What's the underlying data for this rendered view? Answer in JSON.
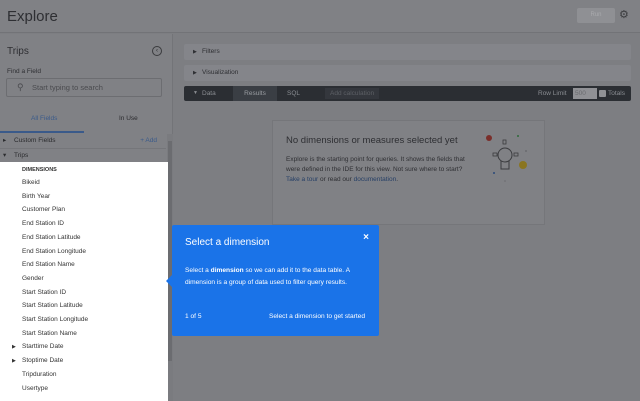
{
  "header": {
    "title": "Explore",
    "run_label": "Run",
    "gear_icon": "gear-icon"
  },
  "sidebar": {
    "title": "Trips",
    "find_label": "Find a Field",
    "search_placeholder": "Start typing to search",
    "tabs": [
      {
        "label": "All Fields"
      },
      {
        "label": "In Use"
      }
    ],
    "custom_fields": "Custom Fields",
    "add_label": "+ Add",
    "trips": "Trips",
    "dimensions_header": "DIMENSIONS",
    "fields": [
      {
        "label": "Bikeid"
      },
      {
        "label": "Birth Year"
      },
      {
        "label": "Customer Plan"
      },
      {
        "label": "End Station ID"
      },
      {
        "label": "End Station Latitude"
      },
      {
        "label": "End Station Longitude"
      },
      {
        "label": "End Station Name"
      },
      {
        "label": "Gender"
      },
      {
        "label": "Start Station ID"
      },
      {
        "label": "Start Station Latitude"
      },
      {
        "label": "Start Station Longitude"
      },
      {
        "label": "Start Station Name"
      },
      {
        "label": "Starttime Date",
        "expandable": true
      },
      {
        "label": "Stoptime Date",
        "expandable": true
      },
      {
        "label": "Tripduration"
      },
      {
        "label": "Usertype"
      }
    ]
  },
  "main": {
    "filters": "Filters",
    "visualization": "Visualization",
    "data_bar": {
      "data": "Data",
      "results": "Results",
      "sql": "SQL",
      "add_calc": "Add calculation",
      "row_limit": "Row Limit",
      "row_limit_value": "500",
      "totals": "Totals"
    },
    "empty": {
      "title": "No dimensions or measures selected yet",
      "desc": "Explore is the starting point for queries. It shows the fields that were defined in the IDE for this view. Not sure where to start?",
      "tour": "Take a tour",
      "mid": " or read our ",
      "docs": "documentation",
      "end": "."
    }
  },
  "tooltip": {
    "title": "Select a dimension",
    "body_pre": "Select a ",
    "body_bold": "dimension",
    "body_post": " so we can add it to the data table. A dimension is a group of data used to filter query results.",
    "close": "×",
    "progress": "1 of 5",
    "action": "Select a dimension to get started"
  }
}
